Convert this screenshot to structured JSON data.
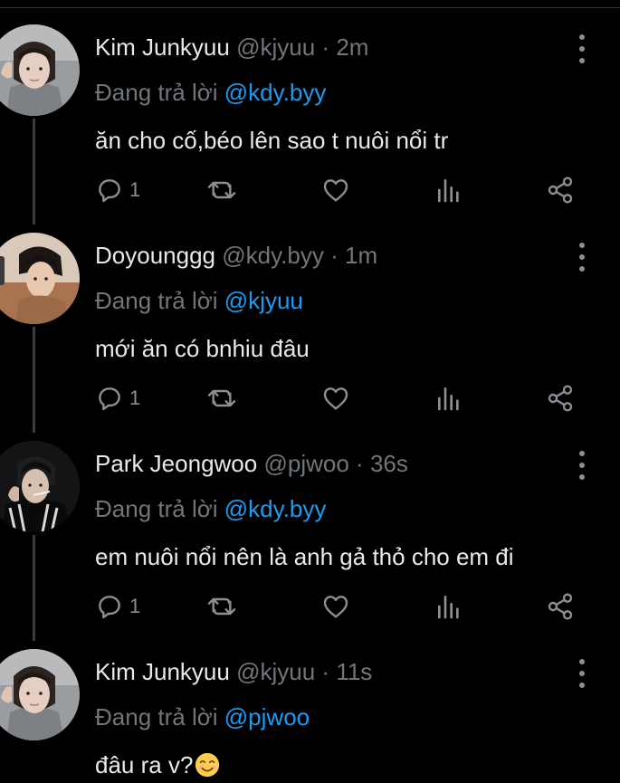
{
  "reply_prefix": "Đang trả lời ",
  "separator": "·",
  "tweets": [
    {
      "name": "Kim Junkyuu",
      "handle": "@kjyuu",
      "time": "2m",
      "reply_to": "@kdy.byy",
      "text": "ăn cho cố,béo lên sao t nuôi nổi tr",
      "reply_count": "1",
      "avatar": "avatar-kim-junkyuu"
    },
    {
      "name": "Doyounggg",
      "handle": "@kdy.byy",
      "time": "1m",
      "reply_to": "@kjyuu",
      "text": "mới ăn có bnhiu đâu",
      "reply_count": "1",
      "avatar": "avatar-doyounggg"
    },
    {
      "name": "Park Jeongwoo",
      "handle": "@pjwoo",
      "time": "36s",
      "reply_to": "@kdy.byy",
      "text": "em nuôi nổi nên là anh gả thỏ cho em đi",
      "reply_count": "1",
      "avatar": "avatar-park-jeongwoo"
    },
    {
      "name": "Kim Junkyuu",
      "handle": "@kjyuu",
      "time": "11s",
      "reply_to": "@pjwoo",
      "text": "đâu ra v?",
      "emoji": "smiling-face-emoji",
      "avatar": "avatar-kim-junkyuu"
    }
  ],
  "icons": {
    "reply": "reply-icon",
    "retweet": "retweet-icon",
    "like": "heart-icon",
    "views": "analytics-icon",
    "share": "share-icon",
    "more": "more-vertical-icon"
  },
  "colors": {
    "background": "#000000",
    "text": "#e7e9ea",
    "muted": "#71767b",
    "mention": "#1d9bf0",
    "icon": "#8b8f94"
  }
}
